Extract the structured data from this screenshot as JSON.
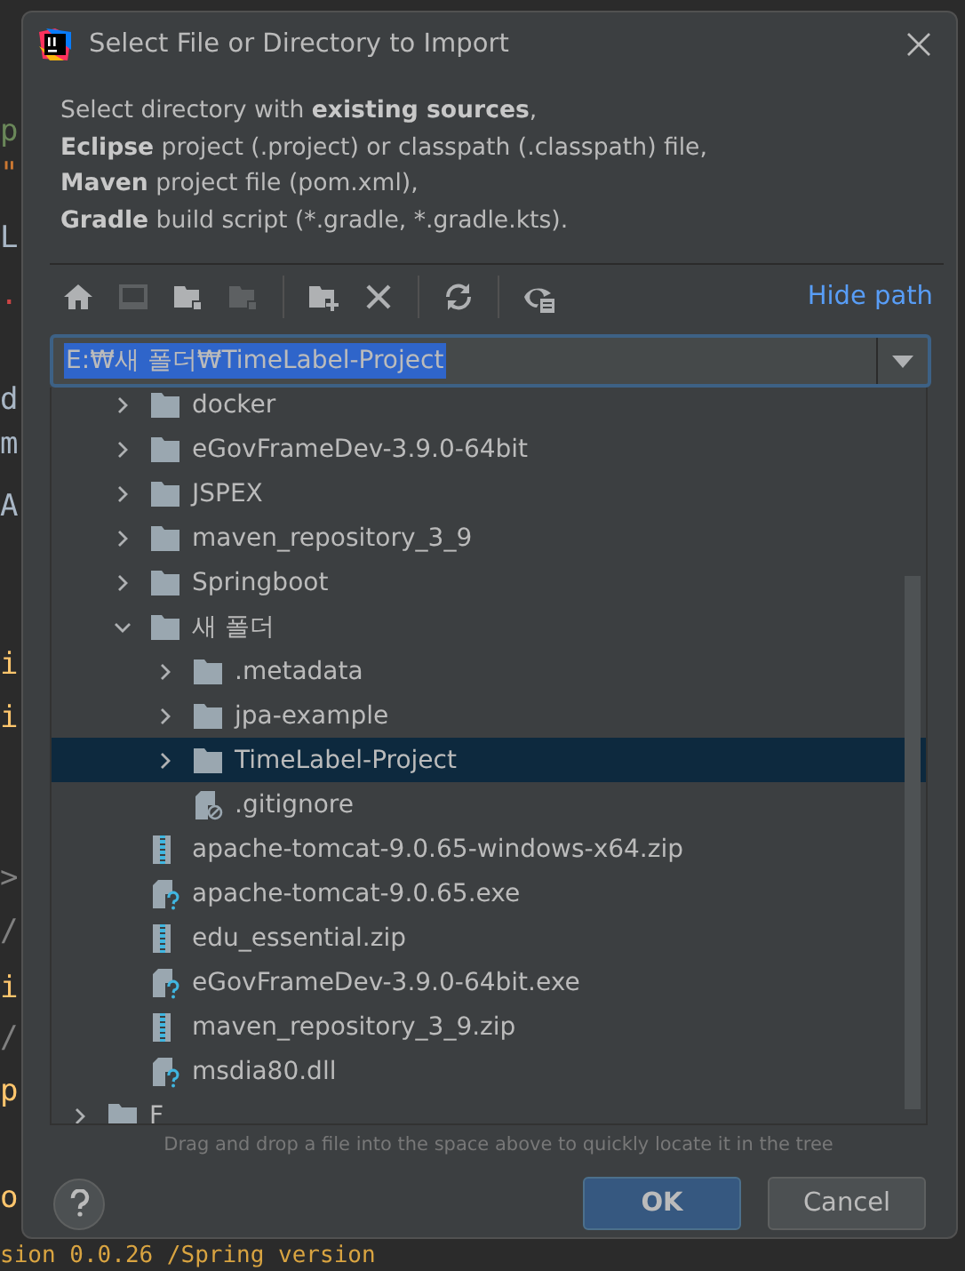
{
  "editor_background": {
    "lines": [
      {
        "text": "p",
        "color": "#6a8759"
      },
      {
        "text": "\"",
        "color": "#cc7832"
      },
      {
        "text": "L",
        "color": "#a9b7c6"
      },
      {
        "text": ".",
        "color": "#cc4444"
      },
      {
        "text": "d",
        "color": "#a9b7c6"
      },
      {
        "text": "m",
        "color": "#a9b7c6"
      },
      {
        "text": "A",
        "color": "#a9b7c6"
      },
      {
        "text": "i",
        "color": "#ffc66d"
      },
      {
        "text": "i",
        "color": "#ffc66d"
      },
      {
        "text": ">",
        "color": "#808080"
      },
      {
        "text": "/",
        "color": "#808080"
      },
      {
        "text": "i",
        "color": "#ffc66d"
      },
      {
        "text": "/",
        "color": "#808080"
      },
      {
        "text": "p",
        "color": "#ffc66d"
      },
      {
        "text": "o",
        "color": "#ffc66d"
      }
    ],
    "bottom_line": "sion 0.0.26 /Spring version"
  },
  "dialog": {
    "title": "Select File or Directory to Import",
    "description": [
      "Select directory with **existing sources**,",
      "**Eclipse** project (.project) or classpath (.classpath) file,",
      "**Maven** project file (pom.xml),",
      "**Gradle** build script (*.gradle, *.gradle.kts)."
    ],
    "toolbar": {
      "groups": [
        [
          {
            "kind": "home",
            "disabled": false
          },
          {
            "kind": "desktop",
            "disabled": true
          },
          {
            "kind": "project",
            "disabled": false
          },
          {
            "kind": "module",
            "disabled": true
          }
        ],
        [
          {
            "kind": "new-folder",
            "disabled": false
          },
          {
            "kind": "delete",
            "disabled": false
          }
        ],
        [
          {
            "kind": "refresh",
            "disabled": false
          }
        ],
        [
          {
            "kind": "hidden",
            "disabled": false
          }
        ]
      ],
      "hide_path_link": "Hide path"
    },
    "path_field": {
      "value": "E:₩새 폴더₩TimeLabel-Project",
      "text_selected": true
    },
    "tree": {
      "nodes": [
        {
          "name": "docker",
          "kind": "folder",
          "expanded": false,
          "selected": false
        },
        {
          "name": "eGovFrameDev-3.9.0-64bit",
          "kind": "folder",
          "expanded": false,
          "selected": false
        },
        {
          "name": "JSPEX",
          "kind": "folder",
          "expanded": false,
          "selected": false
        },
        {
          "name": "maven_repository_3_9",
          "kind": "folder",
          "expanded": false,
          "selected": false
        },
        {
          "name": "Springboot",
          "kind": "folder",
          "expanded": false,
          "selected": false
        },
        {
          "name": "새 폴더",
          "kind": "folder",
          "expanded": true,
          "selected": false,
          "children": [
            {
              "name": ".metadata",
              "kind": "folder",
              "expanded": false,
              "selected": false
            },
            {
              "name": "jpa-example",
              "kind": "folder",
              "expanded": false,
              "selected": false
            },
            {
              "name": "TimeLabel-Project",
              "kind": "folder",
              "expanded": false,
              "selected": true
            },
            {
              "name": ".gitignore",
              "kind": "ignored-file",
              "selected": false
            }
          ]
        },
        {
          "name": "apache-tomcat-9.0.65-windows-x64.zip",
          "kind": "archive",
          "selected": false
        },
        {
          "name": "apache-tomcat-9.0.65.exe",
          "kind": "unknown-file",
          "selected": false
        },
        {
          "name": "edu_essential.zip",
          "kind": "archive",
          "selected": false
        },
        {
          "name": "eGovFrameDev-3.9.0-64bit.exe",
          "kind": "unknown-file",
          "selected": false
        },
        {
          "name": "maven_repository_3_9.zip",
          "kind": "archive",
          "selected": false
        },
        {
          "name": "msdia80.dll",
          "kind": "unknown-file",
          "selected": false
        }
      ],
      "roots_after": [
        {
          "name": "F",
          "kind": "folder",
          "expanded": false,
          "selected": false
        }
      ]
    },
    "hint": "Drag and drop a file into the space above to quickly locate it in the tree",
    "buttons": [
      {
        "label": "OK",
        "kind": "default"
      },
      {
        "label": "Cancel",
        "kind": "normal"
      }
    ]
  }
}
